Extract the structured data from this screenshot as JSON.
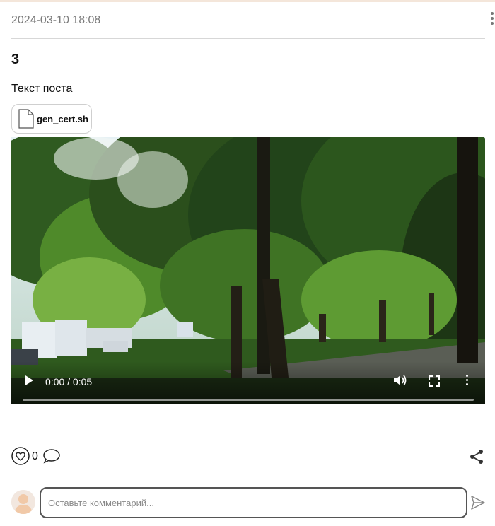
{
  "post": {
    "date": "2024-03-10 18:08",
    "title": "3",
    "text": "Текст поста",
    "attachment": {
      "name": "gen_cert.sh",
      "icon": "file-icon"
    }
  },
  "video": {
    "time": "0:00 / 0:05",
    "progress": 0,
    "icons": [
      "play-icon",
      "volume-icon",
      "fullscreen-icon",
      "more-vertical-icon"
    ]
  },
  "actions": {
    "like_count": "0",
    "icons": [
      "heart-icon",
      "comment-icon",
      "share-icon"
    ]
  },
  "comment": {
    "placeholder": "Оставьте комментарий...",
    "send_icon": "send-icon"
  },
  "colors": {
    "accent": "#555555",
    "divider": "#d7d7d7",
    "muted": "#7a7a7a"
  }
}
